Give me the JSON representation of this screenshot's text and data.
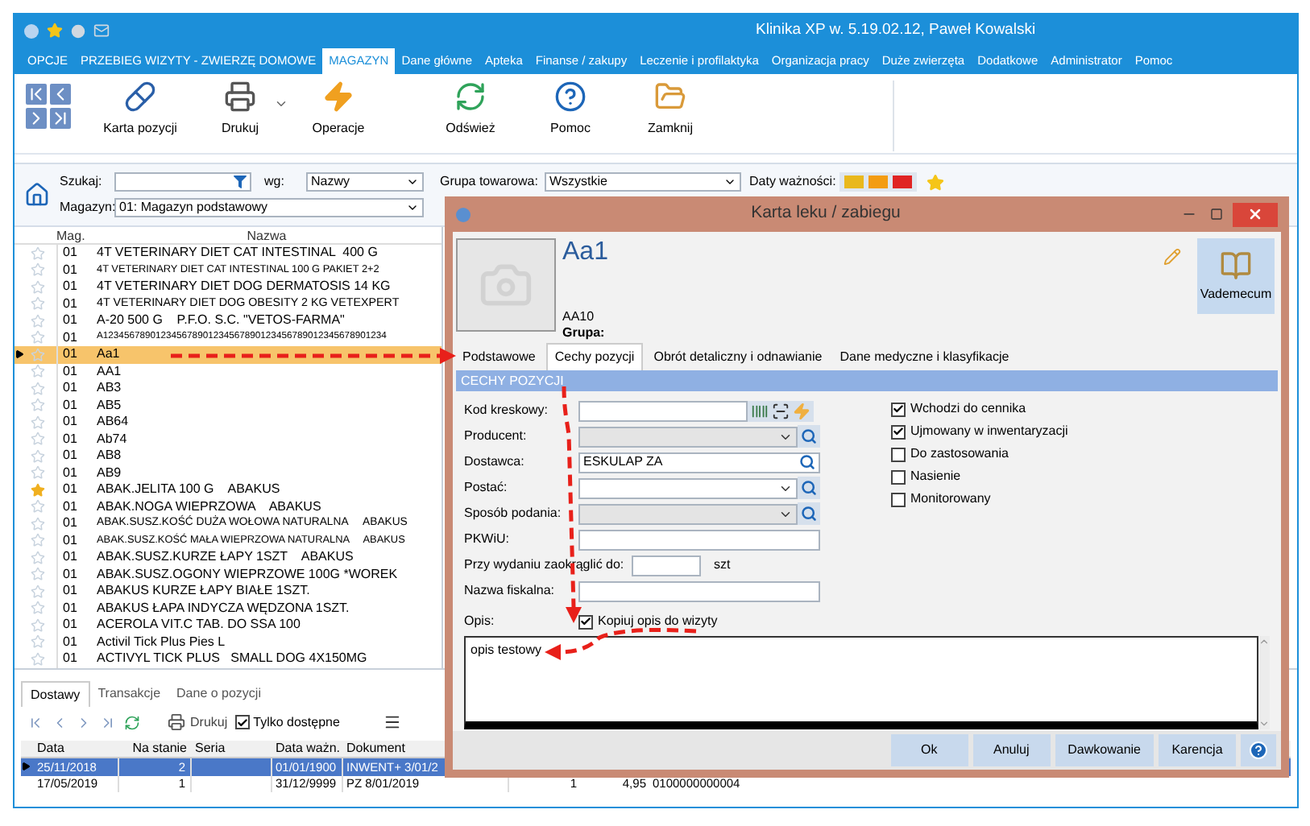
{
  "window": {
    "title": "Klinika XP w. 5.19.02.12, Paweł Kowalski"
  },
  "menu_tabs": [
    {
      "label": "OPCJE",
      "selected": false
    },
    {
      "label": "PRZEBIEG WIZYTY - ZWIERZĘ DOMOWE",
      "selected": false
    },
    {
      "label": "MAGAZYN",
      "selected": true
    },
    {
      "label": "Dane główne",
      "selected": false
    },
    {
      "label": "Apteka",
      "selected": false
    },
    {
      "label": "Finanse / zakupy",
      "selected": false
    },
    {
      "label": "Leczenie i profilaktyka",
      "selected": false
    },
    {
      "label": "Organizacja pracy",
      "selected": false
    },
    {
      "label": "Duże zwierzęta",
      "selected": false
    },
    {
      "label": "Dodatkowe",
      "selected": false
    },
    {
      "label": "Administrator",
      "selected": false
    },
    {
      "label": "Pomoc",
      "selected": false
    }
  ],
  "toolbar": [
    {
      "label": "Karta pozycji",
      "kind": "card"
    },
    {
      "label": "Drukuj",
      "kind": "print",
      "has_menu": true
    },
    {
      "label": "Operacje",
      "kind": "operations"
    },
    {
      "label": "Odśwież",
      "kind": "refresh"
    },
    {
      "label": "Pomoc",
      "kind": "help"
    },
    {
      "label": "Zamknij",
      "kind": "close"
    }
  ],
  "filters": {
    "search": {
      "label": "Szukaj:"
    },
    "by": {
      "label": "wg:",
      "value": "Nazwy"
    },
    "warehouse": {
      "label": "Magazyn:",
      "value": "01: Magazyn podstawowy"
    },
    "group": {
      "label": "Grupa towarowa:",
      "value": "Wszystkie"
    },
    "expiry": {
      "label": "Daty ważności:",
      "options": [
        {
          "color": "#e9b81c"
        },
        {
          "color": "#f39c12"
        },
        {
          "color": "#e02424"
        }
      ]
    }
  },
  "list": {
    "columns": [
      "Mag.",
      "Nazwa"
    ],
    "rows": [
      {
        "mag": "01",
        "name": "4T VETERINARY DIET CAT INTESTINAL  400 G",
        "starred": false,
        "selected": false
      },
      {
        "mag": "01",
        "name": "4T VETERINARY DIET CAT INTESTINAL 100 G PAKIET 2+2",
        "starred": false,
        "selected": false
      },
      {
        "mag": "01",
        "name": "4T VETERINARY DIET DOG DERMATOSIS 14 KG",
        "starred": false,
        "selected": false
      },
      {
        "mag": "01",
        "name": "4T VETERINARY DIET DOG OBESITY 2 KG VETEXPERT",
        "starred": false,
        "selected": false
      },
      {
        "mag": "01",
        "name": "A-20 500 G    P.F.O. S.C. \"VETOS-FARMA\"",
        "starred": false,
        "selected": false
      },
      {
        "mag": "01",
        "name": "A123456789012345678901234567890123456789012345678901234",
        "starred": false,
        "selected": false
      },
      {
        "mag": "01",
        "name": "Aa1",
        "starred": false,
        "selected": true
      },
      {
        "mag": "01",
        "name": "AA1",
        "starred": false,
        "selected": false
      },
      {
        "mag": "01",
        "name": "AB3",
        "starred": false,
        "selected": false
      },
      {
        "mag": "01",
        "name": "AB5",
        "starred": false,
        "selected": false
      },
      {
        "mag": "01",
        "name": "AB64",
        "starred": false,
        "selected": false
      },
      {
        "mag": "01",
        "name": "Ab74",
        "starred": false,
        "selected": false
      },
      {
        "mag": "01",
        "name": "AB8",
        "starred": false,
        "selected": false
      },
      {
        "mag": "01",
        "name": "AB9",
        "starred": false,
        "selected": false
      },
      {
        "mag": "01",
        "name": "ABAK.JELITA 100 G    ABAKUS",
        "starred": true,
        "selected": false
      },
      {
        "mag": "01",
        "name": "ABAK.NOGA WIEPRZOWA    ABAKUS",
        "starred": false,
        "selected": false
      },
      {
        "mag": "01",
        "name": "ABAK.SUSZ.KOŚĆ DUŻA WOŁOWA NATURALNA     ABAKUS",
        "starred": false,
        "selected": false
      },
      {
        "mag": "01",
        "name": "ABAK.SUSZ.KOŚĆ MAŁA WIEPRZOWA NATURALNA     ABAKUS",
        "starred": false,
        "selected": false
      },
      {
        "mag": "01",
        "name": "ABAK.SUSZ.KURZE ŁAPY 1SZT    ABAKUS",
        "starred": false,
        "selected": false
      },
      {
        "mag": "01",
        "name": "ABAK.SUSZ.OGONY WIEPRZOWE 100G *WOREK",
        "starred": false,
        "selected": false
      },
      {
        "mag": "01",
        "name": "ABAKUS KURZE ŁAPY BIAŁE 1SZT.",
        "starred": false,
        "selected": false
      },
      {
        "mag": "01",
        "name": "ABAKUS ŁAPA INDYCZA WĘDZONA 1SZT.",
        "starred": false,
        "selected": false
      },
      {
        "mag": "01",
        "name": "ACEROLA VIT.C TAB. DO SSA 100",
        "starred": false,
        "selected": false
      },
      {
        "mag": "01",
        "name": "Activil Tick Plus Pies L",
        "starred": false,
        "selected": false
      },
      {
        "mag": "01",
        "name": "ACTIVYL TICK PLUS   SMALL DOG 4X150MG",
        "starred": false,
        "selected": false
      }
    ]
  },
  "bottom_panel": {
    "tabs": [
      {
        "label": "Dostawy",
        "selected": true
      },
      {
        "label": "Transakcje",
        "selected": false
      },
      {
        "label": "Dane o pozycji",
        "selected": false
      }
    ],
    "print_label": "Drukuj",
    "available_only": {
      "label": "Tylko dostępne",
      "checked": true
    },
    "columns": [
      "Data",
      "Na stanie",
      "Seria",
      "Data ważn.",
      "Dokument"
    ],
    "rows": [
      {
        "date": "25/11/2018",
        "quantity": "2",
        "expiry": "01/01/1900",
        "document": "INWENT+ 3/01/2",
        "selected": true
      },
      {
        "date": "17/05/2019",
        "quantity": "1",
        "expiry": "31/12/9999",
        "document": "PZ 8/01/2019",
        "column_6": "1",
        "column_7": "4,95",
        "column_8": "0100000000004",
        "selected": false
      }
    ]
  },
  "dialog": {
    "title": "Karta leku / zabiegu",
    "name": "Aa1",
    "code": "AA10",
    "group_label": "Grupa:",
    "vademecum": "Vademecum",
    "tabs": [
      {
        "label": "Podstawowe",
        "selected": false
      },
      {
        "label": "Cechy pozycji",
        "selected": true
      },
      {
        "label": "Obrót detaliczny i odnawianie",
        "selected": false
      },
      {
        "label": "Dane medyczne i klasyfikacje",
        "selected": false
      }
    ],
    "section": "CECHY POZYCJI",
    "fields": [
      {
        "label": "Kod kreskowy:",
        "kind": "barcode"
      },
      {
        "label": "Producent:",
        "kind": "combo",
        "disabled": true
      },
      {
        "label": "Dostawca:",
        "kind": "search",
        "value": "ESKULAP ZA"
      },
      {
        "label": "Postać:",
        "kind": "combo",
        "disabled": false
      },
      {
        "label": "Sposób podania:",
        "kind": "combo",
        "disabled": true
      },
      {
        "label": "PKWiU:",
        "kind": "text"
      },
      {
        "label": "Przy wydaniu zaokrąglić do:",
        "kind": "quantity",
        "unit": "szt"
      },
      {
        "label": "Nazwa fiskalna:",
        "kind": "text"
      }
    ],
    "checkboxes": [
      {
        "label": "Wchodzi do cennika",
        "checked": true
      },
      {
        "label": "Ujmowany w inwentaryzacji",
        "checked": true
      },
      {
        "label": "Do zastosowania",
        "checked": false
      },
      {
        "label": "Nasienie",
        "checked": false
      },
      {
        "label": "Monitorowany",
        "checked": false
      }
    ],
    "description": {
      "label": "Opis:",
      "copy": {
        "label": "Kopiuj opis do wizyty",
        "checked": true
      },
      "value": "opis testowy"
    },
    "buttons": [
      "Ok",
      "Anuluj",
      "Dawkowanie",
      "Karencja"
    ]
  }
}
